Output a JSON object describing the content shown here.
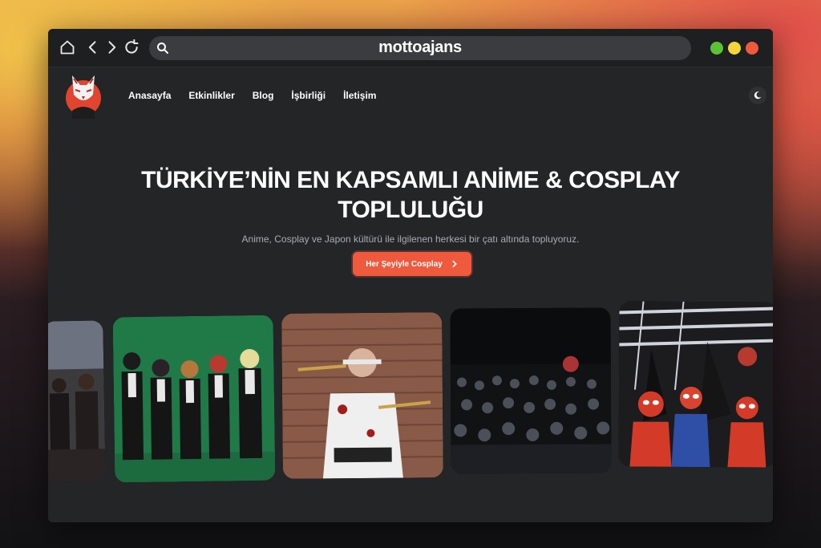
{
  "browser": {
    "url_display": "mottoajans",
    "nav_icons": [
      "home-icon",
      "back-icon",
      "forward-icon",
      "reload-icon"
    ],
    "search_icon": "search-icon",
    "window_controls": [
      {
        "name": "green",
        "color": "#5bc236"
      },
      {
        "name": "yellow",
        "color": "#f5d63a"
      },
      {
        "name": "red",
        "color": "#f05a3c"
      }
    ]
  },
  "site": {
    "logo": "fox-mask-logo",
    "nav": [
      {
        "label": "Anasayfa"
      },
      {
        "label": "Etkinlikler"
      },
      {
        "label": "Blog"
      },
      {
        "label": "İşbirliği"
      },
      {
        "label": "İletişim"
      }
    ],
    "theme_toggle_icon": "moon-icon"
  },
  "hero": {
    "title_line1": "TÜRKİYE’NİN EN KAPSAMLI ANİME & COSPLAY",
    "title_line2": "TOPLULUĞU",
    "subtitle": "Anime, Cosplay ve Japon kültürü ile ilgilenen herkesi bir çatı altında topluyoruz.",
    "cta_label": "Her Şeyiyle Cosplay",
    "cta_icon": "chevron-right-icon"
  },
  "colors": {
    "accent": "#ef5a3e",
    "page_bg": "#232527",
    "text": "#ffffff",
    "muted": "#a9acb0"
  },
  "gallery": [
    {
      "name": "photo-group-cosplay-partial"
    },
    {
      "name": "photo-group-suits-cosplay"
    },
    {
      "name": "photo-sword-cosplayer"
    },
    {
      "name": "photo-event-crowd"
    },
    {
      "name": "photo-spiderman-cosplay"
    }
  ]
}
